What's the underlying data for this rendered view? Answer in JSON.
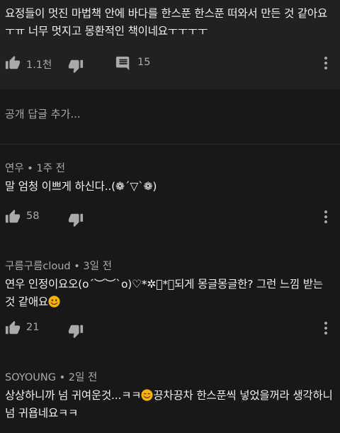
{
  "top_comment": {
    "text": "요정들이 멋진 마법책 안에 바다를 한스푼 한스푼 떠와서 만든 것 같아요ㅜㅠ 너무 멋지고 몽환적인 책이네요ㅜㅜㅜㅜ",
    "likes": "1.1천",
    "replies": "15"
  },
  "reply_placeholder": "공개 답글 추가...",
  "comments": [
    {
      "author": "연우",
      "time": "1주 전",
      "text": "말 엄청 이쁘게 하신다..(❁´▽`❁)",
      "likes": "58"
    },
    {
      "author": "구름구름cloud",
      "time": "3일 전",
      "text_before_emoji": "연우 인정이요오(o´︶︶`o)♡*✲゚*。되게 몽글몽글한? 그런 느낌 받는 것 같애요",
      "text_after_emoji": "",
      "likes": "21"
    },
    {
      "author": "SOYOUNG",
      "time": "2일 전",
      "text_before_emoji": "상상하니까 넘 귀여운것...ㅋㅋ",
      "text_after_emoji": "끙차끙차 한스푼씩 넣었을꺼라 생각하니 넘 귀욥네요ㅋㅋ"
    }
  ],
  "separator": "•",
  "icons": {
    "like": "thumbs-up-icon",
    "dislike": "thumbs-down-icon",
    "reply": "comment-icon",
    "more": "more-vertical-icon",
    "emoji": "smiling-face-emoji"
  },
  "colors": {
    "background": "#181818",
    "top_block": "#212121",
    "text": "#f1f1f1",
    "secondary": "#aaaaaa",
    "emoji": "#f7b500"
  }
}
